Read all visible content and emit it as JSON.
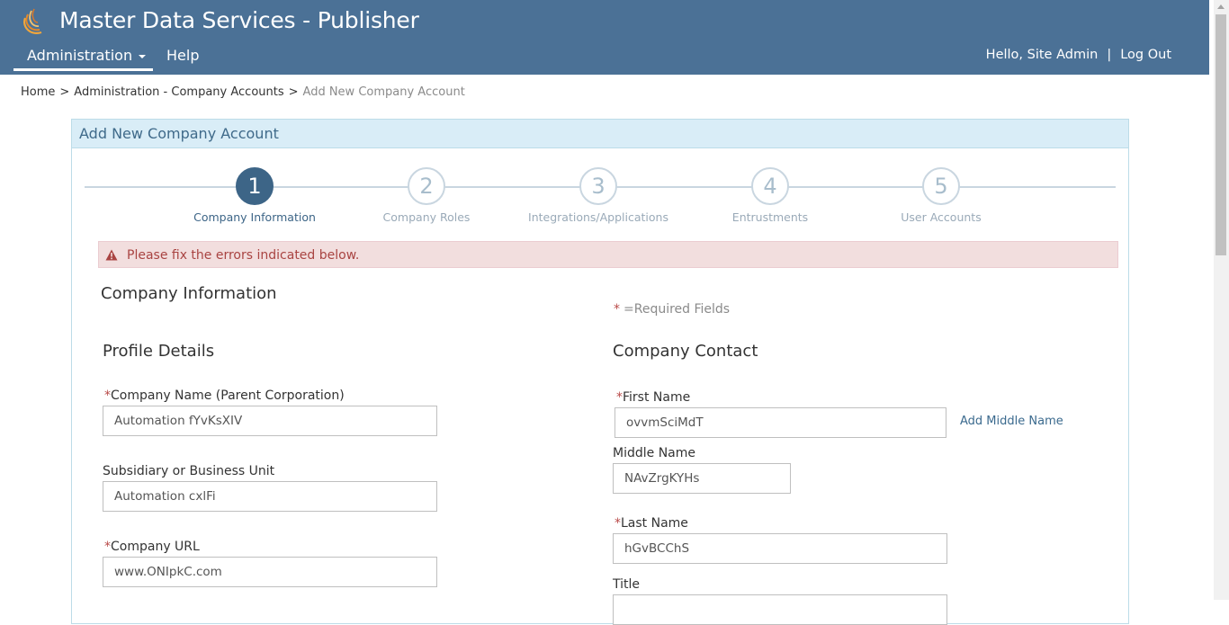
{
  "app": {
    "title": "Master Data Services - Publisher"
  },
  "nav": {
    "administration": "Administration",
    "help": "Help"
  },
  "user": {
    "greeting": "Hello, Site Admin",
    "separator": "|",
    "logout": "Log Out"
  },
  "breadcrumb": {
    "home": "Home",
    "company_accounts": "Administration - Company Accounts",
    "current": "Add New Company Account",
    "separator": ">"
  },
  "panel": {
    "heading": "Add New Company Account"
  },
  "wizard": {
    "active_step": 1,
    "steps": [
      {
        "number": "1",
        "label": "Company Information"
      },
      {
        "number": "2",
        "label": "Company Roles"
      },
      {
        "number": "3",
        "label": "Integrations/Applications"
      },
      {
        "number": "4",
        "label": "Entrustments"
      },
      {
        "number": "5",
        "label": "User Accounts"
      }
    ]
  },
  "alert": {
    "message": "Please fix the errors indicated below."
  },
  "form": {
    "section_title": "Company Information",
    "required_note": "=Required Fields",
    "required_star": "*",
    "profile": {
      "title": "Profile Details",
      "company_name_label": "Company Name (Parent Corporation)",
      "company_name_value": "Automation fYvKsXIV",
      "subsidiary_label": "Subsidiary or Business Unit",
      "subsidiary_value": "Automation cxlFi",
      "url_label": "Company URL",
      "url_value": "www.ONIpkC.com"
    },
    "contact": {
      "title": "Company Contact",
      "first_name_label": "First Name",
      "first_name_value": "ovvmSciMdT",
      "add_middle_name": "Add Middle Name",
      "middle_name_label": "Middle Name",
      "middle_name_value": "NAvZrgKYHs",
      "last_name_label": "Last Name",
      "last_name_value": "hGvBCChS",
      "title_label": "Title",
      "title_value": ""
    }
  },
  "colors": {
    "header_bg": "#4b7196",
    "panel_heading_bg": "#d9edf7",
    "step_active": "#3d6587",
    "alert_bg": "#f2dede",
    "alert_text": "#a94442",
    "required_star": "#b94a48",
    "link": "#3b6a8e"
  },
  "icons": {
    "logo": "swirl-logo-icon",
    "alert": "warning-triangle-icon",
    "dropdown": "caret-down-icon"
  }
}
